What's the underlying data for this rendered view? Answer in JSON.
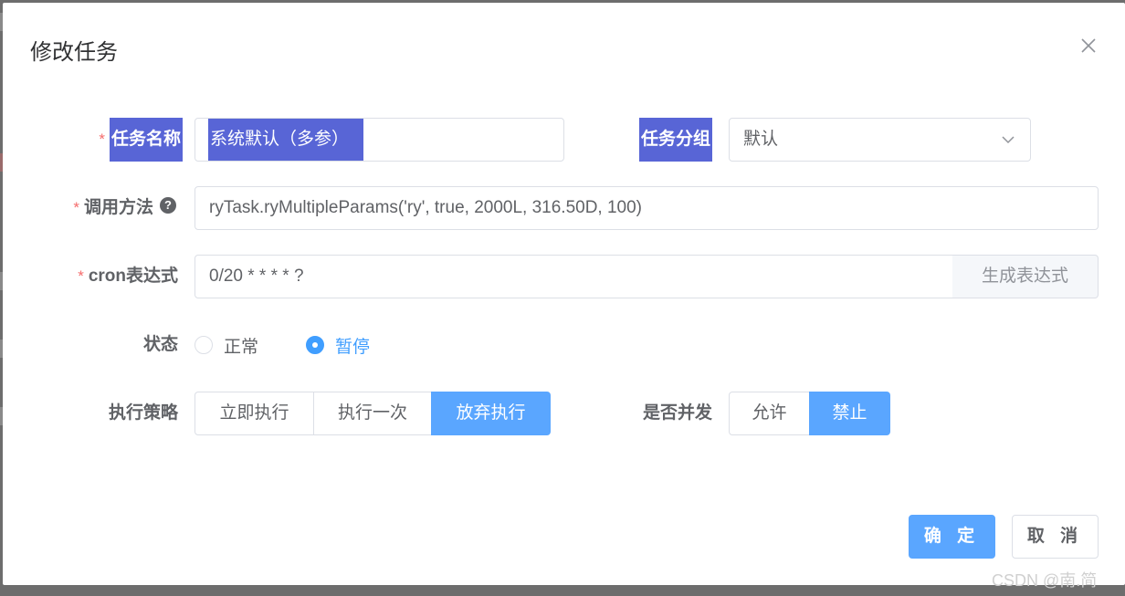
{
  "dialog": {
    "title": "修改任务",
    "close_icon": "close-icon"
  },
  "form": {
    "job_name": {
      "label": "任务名称",
      "required": "*",
      "value": "系统默认（多参）"
    },
    "job_group": {
      "label": "任务分组",
      "value": "默认",
      "icon": "chevron-down-icon"
    },
    "invoke_target": {
      "label": "调用方法",
      "required": "*",
      "help": "?",
      "value": "ryTask.ryMultipleParams('ry', true, 2000L, 316.50D, 100)"
    },
    "cron": {
      "label": "cron表达式",
      "required": "*",
      "value": "0/20 * * * * ?",
      "append_label": "生成表达式"
    },
    "status": {
      "label": "状态",
      "options": [
        "正常",
        "暂停"
      ],
      "selected": "暂停"
    },
    "misfire": {
      "label": "执行策略",
      "options": [
        "立即执行",
        "执行一次",
        "放弃执行"
      ],
      "selected": "放弃执行"
    },
    "concurrent": {
      "label": "是否并发",
      "options": [
        "允许",
        "禁止"
      ],
      "selected": "禁止"
    }
  },
  "footer": {
    "confirm_label": "确 定",
    "cancel_label": "取 消"
  },
  "watermark": "CSDN @南.简",
  "colors": {
    "primary": "#5aa6ff",
    "selection_highlight": "#5865d6",
    "required_star": "#f56c6c"
  }
}
